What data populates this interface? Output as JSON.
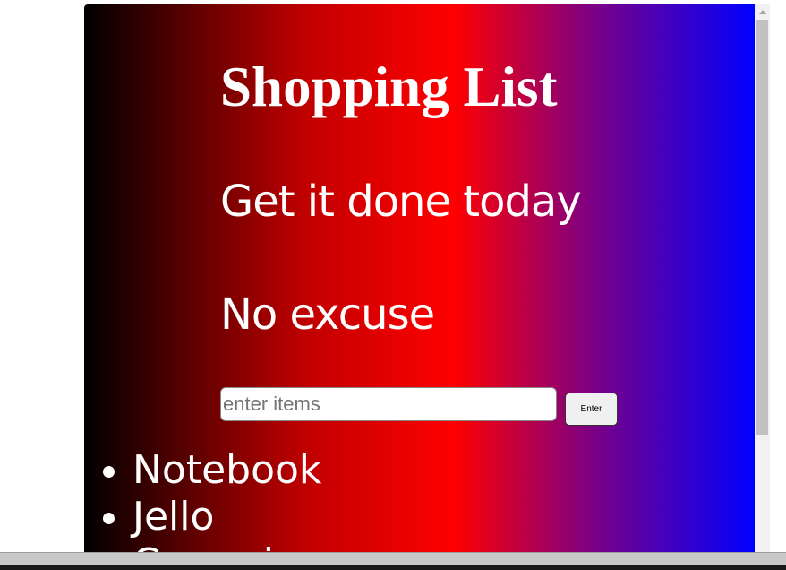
{
  "page": {
    "title": "Shopping List",
    "taglines": [
      "Get it done today",
      "No excuse"
    ]
  },
  "form": {
    "input_value": "",
    "input_placeholder": "enter items",
    "enter_label": "Enter"
  },
  "list": {
    "items": [
      "Notebook",
      "Jello",
      "Ceramic"
    ]
  },
  "colors": {
    "gradient": [
      "#000000",
      "#c00000",
      "#ff0000",
      "#800080",
      "#0000ff"
    ],
    "text": "#ffffff"
  }
}
